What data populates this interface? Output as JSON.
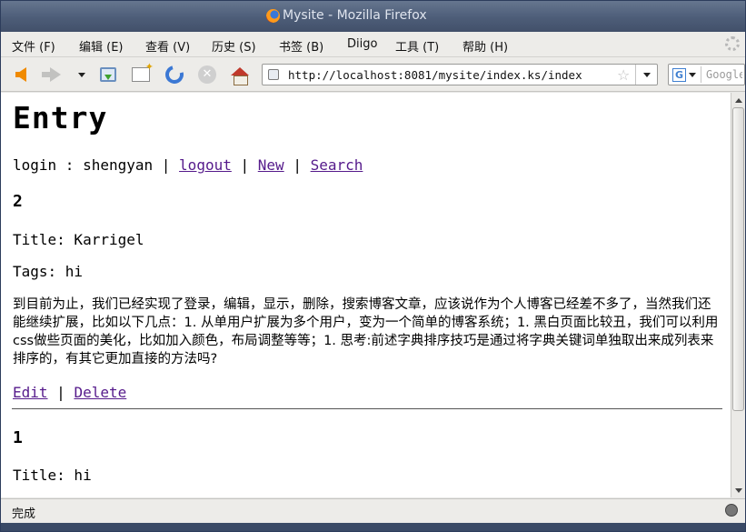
{
  "window": {
    "title": "Mysite - Mozilla Firefox"
  },
  "menubar": {
    "items": [
      {
        "label": "文件 (F)"
      },
      {
        "label": "编辑 (E)"
      },
      {
        "label": "查看 (V)"
      },
      {
        "label": "历史 (S)"
      },
      {
        "label": "书签 (B)"
      },
      {
        "label": "Diigo"
      },
      {
        "label": "工具 (T)"
      },
      {
        "label": "帮助 (H)"
      }
    ]
  },
  "navbar": {
    "url": "http://localhost:8081/mysite/index.ks/index",
    "search_placeholder": "Google"
  },
  "page": {
    "heading": "Entry",
    "login_prefix": "login : shengyan",
    "separator": "|",
    "links": {
      "logout": "logout",
      "new": "New",
      "search": "Search"
    },
    "entries": [
      {
        "id": "2",
        "title_line": "Title: Karrigel",
        "tags_line": "Tags: hi",
        "body": "到目前为止，我们已经实现了登录，编辑，显示，删除，搜索博客文章，应该说作为个人博客已经差不多了，当然我们还能继续扩展，比如以下几点：1. 从单用户扩展为多个用户，变为一个简单的博客系统；1. 黑白页面比较丑，我们可以利用css做些页面的美化，比如加入颜色，布局调整等等；1. 思考:前述字典排序技巧是通过将字典关键词单独取出来成列表来排序的，有其它更加直接的方法吗?",
        "edit_label": "Edit",
        "delete_label": "Delete"
      },
      {
        "id": "1",
        "title_line": "Title: hi"
      }
    ]
  },
  "statusbar": {
    "text": "完成"
  },
  "colors": {
    "link_visited": "#551a8b",
    "titlebar": "#4d5d78"
  }
}
